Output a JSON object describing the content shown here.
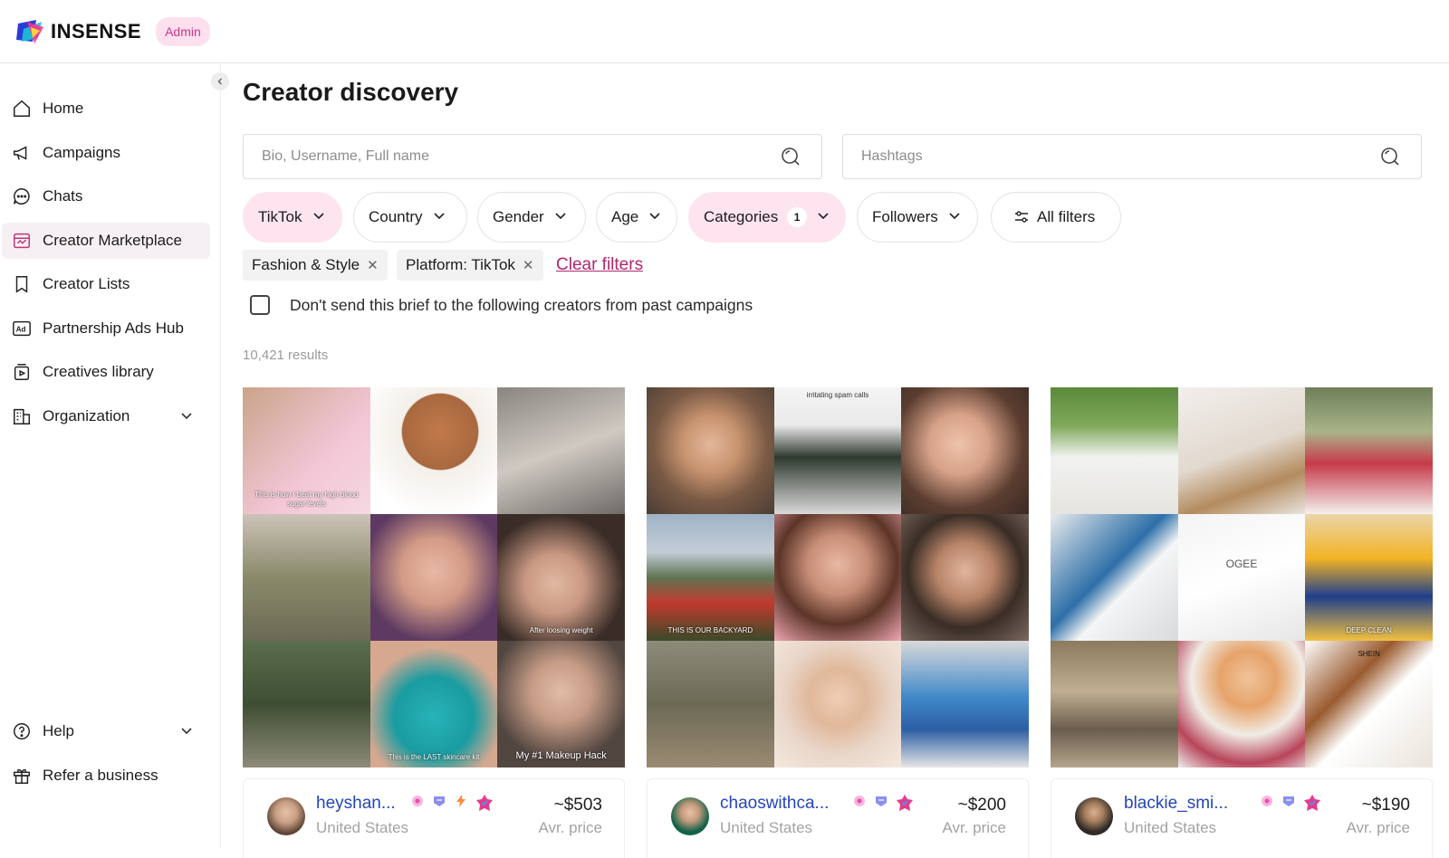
{
  "app": {
    "name": "INSENSE",
    "badge": "Admin"
  },
  "sidebar": {
    "items": [
      {
        "label": "Home",
        "icon": "home-icon"
      },
      {
        "label": "Campaigns",
        "icon": "megaphone-icon"
      },
      {
        "label": "Chats",
        "icon": "chat-icon"
      },
      {
        "label": "Creator Marketplace",
        "icon": "marketplace-icon",
        "active": true
      },
      {
        "label": "Creator Lists",
        "icon": "bookmark-icon"
      },
      {
        "label": "Partnership Ads Hub",
        "icon": "ad-icon"
      },
      {
        "label": "Creatives library",
        "icon": "library-icon"
      },
      {
        "label": "Organization",
        "icon": "building-icon"
      }
    ],
    "bottom_items": [
      {
        "label": "Help",
        "icon": "help-icon"
      },
      {
        "label": "Refer a business",
        "icon": "gift-icon"
      }
    ]
  },
  "main": {
    "title": "Creator discovery",
    "search": {
      "placeholder": "Bio, Username, Full name"
    },
    "hashtags": {
      "placeholder": "Hashtags"
    },
    "filters": {
      "platform": "TikTok",
      "country": "Country",
      "gender": "Gender",
      "age": "Age",
      "categories": "Categories",
      "categories_count": "1",
      "followers": "Followers",
      "all_filters": "All filters"
    },
    "active_tags": [
      "Fashion & Style",
      "Platform: TikTok"
    ],
    "clear_filters": "Clear filters",
    "exclude_checkbox": "Don't send this brief to the following creators from past campaigns",
    "results": "10,421 results",
    "tile_captions": {
      "c1t2": "This is how I beat my high blood sugar levels",
      "c1t9": "After loosing weight",
      "c1t8": "This is the LAST skincare kit",
      "c1t10": "My #1 Makeup Hack",
      "c2t2": "irritating spam calls",
      "c2t4": "THIS IS OUR BACKYARD",
      "c3t6": "OGEE",
      "c3t7": "DEEP CLEAN",
      "c3t9": "SHEIN"
    },
    "cards": [
      {
        "username": "heyshan...",
        "location": "United States",
        "price": "~$503",
        "price_label": "Avr. price"
      },
      {
        "username": "chaoswithca...",
        "location": "United States",
        "price": "~$200",
        "price_label": "Avr. price"
      },
      {
        "username": "blackie_smi...",
        "location": "United States",
        "price": "~$190",
        "price_label": "Avr. price"
      }
    ]
  },
  "colors": {
    "accent": "#b0266d",
    "pink_bg": "#fde4ee",
    "link_blue": "#2446b8"
  }
}
